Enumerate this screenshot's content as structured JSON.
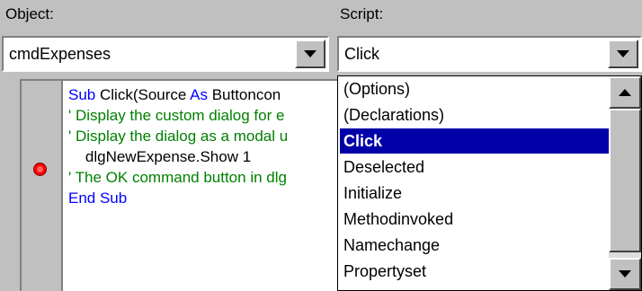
{
  "object_label": "Object:",
  "script_label": "Script:",
  "object_combo": {
    "value": "cmdExpenses"
  },
  "script_combo": {
    "value": "Click"
  },
  "code": {
    "lines": [
      {
        "parts": [
          {
            "t": "Sub ",
            "c": "kw"
          },
          {
            "t": "Click(Source ",
            "c": "tx"
          },
          {
            "t": "As ",
            "c": "kw"
          },
          {
            "t": "Buttoncon",
            "c": "tx"
          }
        ]
      },
      {
        "parts": [
          {
            "t": "' Display the custom dialog for e",
            "c": "cm"
          }
        ]
      },
      {
        "parts": [
          {
            "t": "' Display the dialog as a modal u",
            "c": "cm"
          }
        ]
      },
      {
        "parts": [
          {
            "t": "    dlgNewExpense.Show 1",
            "c": "tx"
          }
        ]
      },
      {
        "parts": [
          {
            "t": "' The OK command button in dlg",
            "c": "cm"
          }
        ]
      },
      {
        "parts": [
          {
            "t": "End Sub",
            "c": "kw"
          }
        ]
      }
    ],
    "breakpoint_line": 4
  },
  "script_dropdown": {
    "items": [
      "(Options)",
      "(Declarations)",
      "Click",
      "Deselected",
      "Initialize",
      "Methodinvoked",
      "Namechange",
      "Propertyset"
    ],
    "selected_index": 2
  },
  "icons": {
    "combo_arrow": "chevron-down-icon",
    "scroll_up": "scroll-up-arrow-icon",
    "scroll_down": "scroll-down-arrow-icon",
    "breakpoint": "breakpoint-icon"
  },
  "colors": {
    "keyword": "#0000ff",
    "comment": "#008000",
    "selection": "#0000a8",
    "breakpoint": "#ff0000",
    "chrome": "#c0c0c0"
  }
}
